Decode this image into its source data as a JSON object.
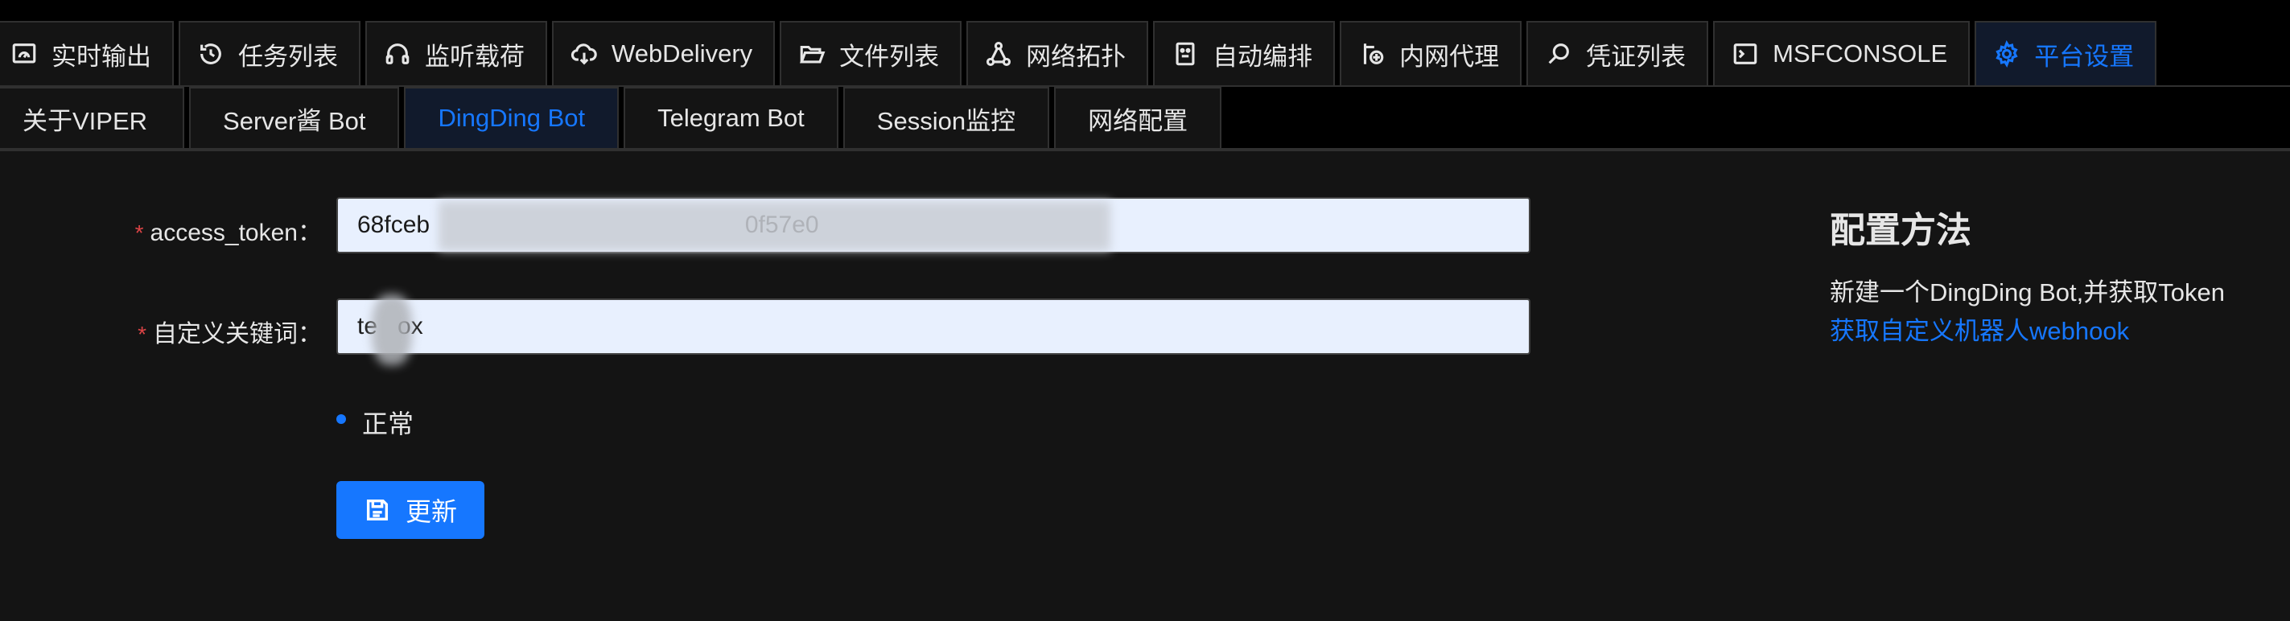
{
  "top_tabs": [
    {
      "label": "实时输出",
      "icon": "dashboard-icon"
    },
    {
      "label": "任务列表",
      "icon": "history-icon"
    },
    {
      "label": "监听载荷",
      "icon": "headphones-icon"
    },
    {
      "label": "WebDelivery",
      "icon": "cloud-download-icon"
    },
    {
      "label": "文件列表",
      "icon": "folder-open-icon"
    },
    {
      "label": "网络拓扑",
      "icon": "network-icon"
    },
    {
      "label": "自动编排",
      "icon": "robot-icon"
    },
    {
      "label": "内网代理",
      "icon": "proxy-icon"
    },
    {
      "label": "凭证列表",
      "icon": "search-icon"
    },
    {
      "label": "MSFCONSOLE",
      "icon": "terminal-icon"
    },
    {
      "label": "平台设置",
      "icon": "gear-icon"
    }
  ],
  "sub_tabs": [
    "关于VIPER",
    "Server酱 Bot",
    "DingDing Bot",
    "Telegram Bot",
    "Session监控",
    "网络配置"
  ],
  "active_top_tab": "平台设置",
  "active_sub_tab": "DingDing Bot",
  "form": {
    "access_token_label": "access_token",
    "access_token_value": "68fceb                                               0f57e0",
    "keyword_label": "自定义关键词",
    "keyword_value": "te   ox",
    "status_text": "正常",
    "update_button": "更新"
  },
  "help": {
    "title": "配置方法",
    "text": "新建一个DingDing Bot,并获取Token",
    "link": "获取自定义机器人webhook"
  },
  "colors": {
    "accent": "#1677ff",
    "background": "#141414",
    "required": "#dc4446"
  }
}
